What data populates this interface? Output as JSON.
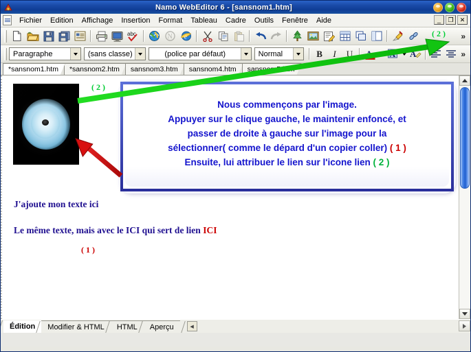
{
  "window": {
    "title": "Namo WebEditor 6 - [sansnom1.htm]",
    "app_icon": "app-logo-icon",
    "orbs": [
      {
        "name": "minimize-orb",
        "color": "#e8a01a"
      },
      {
        "name": "maximize-orb",
        "color": "#3bb316"
      },
      {
        "name": "close-orb",
        "color": "#d42b18"
      }
    ],
    "mdi_buttons": [
      "_",
      "❐",
      "✕"
    ]
  },
  "menubar": {
    "grip": "menu-grip",
    "items": [
      "Fichier",
      "Edition",
      "Affichage",
      "Insertion",
      "Format",
      "Tableau",
      "Cadre",
      "Outils",
      "Fenêtre",
      "Aide"
    ]
  },
  "toolbar_main": {
    "overflow_label": "»",
    "buttons": [
      {
        "name": "new-document-icon",
        "title": "Nouveau"
      },
      {
        "name": "open-folder-icon",
        "title": "Ouvrir"
      },
      {
        "name": "save-icon",
        "title": "Enregistrer"
      },
      {
        "name": "save-all-icon",
        "title": "Enregistrer tout"
      },
      {
        "name": "properties-icon",
        "title": "Propriétés"
      },
      {
        "name": "print-icon",
        "title": "Imprimer"
      },
      {
        "name": "preview-monitor-icon",
        "title": "Aperçu"
      },
      {
        "name": "spellcheck-abc-icon",
        "title": "Orthographe"
      },
      {
        "name": "publish-globe-icon",
        "title": "Publier"
      },
      {
        "name": "disabled-site-icon",
        "title": "Site"
      },
      {
        "name": "internet-explorer-icon",
        "title": "Navigateur"
      },
      {
        "name": "cut-scissors-icon",
        "title": "Couper"
      },
      {
        "name": "copy-icon",
        "title": "Copier"
      },
      {
        "name": "paste-icon",
        "title": "Coller"
      },
      {
        "name": "undo-arrow-icon",
        "title": "Annuler"
      },
      {
        "name": "redo-arrow-icon",
        "title": "Rétablir"
      },
      {
        "name": "tree-clipart-icon",
        "title": "Clipart"
      },
      {
        "name": "insert-image-icon",
        "title": "Image"
      },
      {
        "name": "edit-note-icon",
        "title": "Editer"
      },
      {
        "name": "insert-table-icon",
        "title": "Tableau"
      },
      {
        "name": "layer-icon",
        "title": "Calque"
      },
      {
        "name": "frame-icon",
        "title": "Cadre"
      },
      {
        "name": "anchor-bookmark-icon",
        "title": "Signet"
      },
      {
        "name": "hyperlink-chain-icon",
        "title": "Lien"
      }
    ]
  },
  "toolbar_format": {
    "overflow_label": "»",
    "paragraph_combo": "Paragraphe",
    "class_combo": "(sans classe)",
    "font_combo": "(police par défaut)",
    "size_combo": "Normal",
    "bold": "B",
    "italic": "I",
    "underline": "U",
    "font_color": "A",
    "highlight_color": "A",
    "clear_format": "A",
    "align_left": "align-left-icon",
    "align_center": "align-center-icon"
  },
  "document_tabs": [
    {
      "label": "*sansnom1.htm",
      "active": true
    },
    {
      "label": "*sansnom2.htm",
      "active": false
    },
    {
      "label": "sansnom3.htm",
      "active": false
    },
    {
      "label": "sansnom4.htm",
      "active": false
    },
    {
      "label": "sansnom5.htm",
      "active": false
    }
  ],
  "canvas": {
    "image_alt": "eye-image-thumbnail",
    "callout_lines": [
      {
        "text": "Nous commençons par l'image.",
        "mark": "",
        "mark_color": ""
      },
      {
        "text": "Appuyer sur le clique gauche, le maintenir enfoncé, et",
        "mark": "",
        "mark_color": ""
      },
      {
        "text": "passer de droite à gauche sur l'image pour la",
        "mark": "",
        "mark_color": ""
      },
      {
        "text": "sélectionner( comme le dépard d'un copier coller)",
        "mark": "( 1 )",
        "mark_color": "red"
      },
      {
        "text": "Ensuite, lui attribuer le lien sur l'icone lien",
        "mark": "( 2 )",
        "mark_color": "green"
      }
    ],
    "paragraph_1": "J'ajoute mon texte ici",
    "paragraph_2": "Le même texte, mais avec le ICI qui sert de lien",
    "paragraph_2_link": "ICI",
    "annotations": {
      "red_arrow_label": "( 1 )",
      "green_arrow_label_canvas": "( 2 )",
      "green_arrow_label_toolbar": "( 2 )",
      "red_color": "#cc0000",
      "green_color": "#00cc33"
    }
  },
  "view_tabs": [
    {
      "label": "Édition",
      "active": true
    },
    {
      "label": "Modifier & HTML",
      "active": false
    },
    {
      "label": "HTML",
      "active": false
    },
    {
      "label": "Aperçu",
      "active": false
    }
  ]
}
